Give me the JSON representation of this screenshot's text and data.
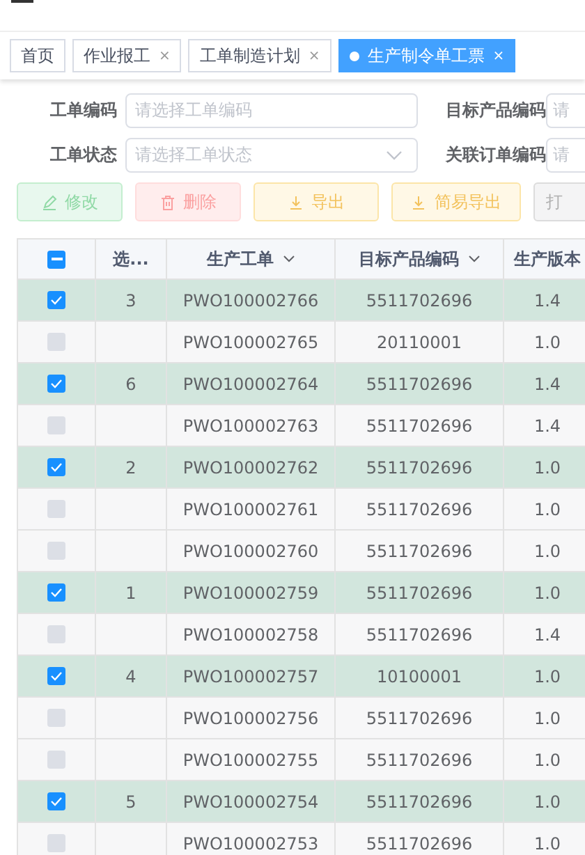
{
  "tabs": [
    {
      "label": "首页",
      "selected": false,
      "closable": false
    },
    {
      "label": "作业报工",
      "selected": false,
      "closable": true
    },
    {
      "label": "工单制造计划",
      "selected": false,
      "closable": true
    },
    {
      "label": "生产制令单工票",
      "selected": true,
      "closable": true
    }
  ],
  "tab_close": "×",
  "filters": [
    {
      "label": "工单编码",
      "placeholder": "请选择工单编码",
      "kind": "input"
    },
    {
      "label": "目标产品编码",
      "placeholder": "请",
      "kind": "input"
    },
    {
      "label": "工单状态",
      "placeholder": "请选择工单状态",
      "kind": "select"
    },
    {
      "label": "关联订单编码",
      "placeholder": "请",
      "kind": "input"
    }
  ],
  "toolbar": [
    {
      "label": "修改",
      "kind": "edit"
    },
    {
      "label": "删除",
      "kind": "delete"
    },
    {
      "label": "导出",
      "kind": "export"
    },
    {
      "label": "简易导出",
      "kind": "export"
    },
    {
      "label": "打",
      "kind": "plain"
    }
  ],
  "table": {
    "header_checkbox_indeterminate": true,
    "columns": [
      {
        "label": "选...",
        "sortable": false
      },
      {
        "label": "生产工单",
        "sortable": true
      },
      {
        "label": "目标产品编码",
        "sortable": true
      },
      {
        "label": "生产版本",
        "sortable": false
      }
    ],
    "rows": [
      {
        "selected": true,
        "order": "3",
        "work_order": "PWO100002766",
        "product_code": "5511702696",
        "version": "1.4"
      },
      {
        "selected": false,
        "order": "",
        "work_order": "PWO100002765",
        "product_code": "20110001",
        "version": "1.0"
      },
      {
        "selected": true,
        "order": "6",
        "work_order": "PWO100002764",
        "product_code": "5511702696",
        "version": "1.4"
      },
      {
        "selected": false,
        "order": "",
        "work_order": "PWO100002763",
        "product_code": "5511702696",
        "version": "1.4"
      },
      {
        "selected": true,
        "order": "2",
        "work_order": "PWO100002762",
        "product_code": "5511702696",
        "version": "1.0"
      },
      {
        "selected": false,
        "order": "",
        "work_order": "PWO100002761",
        "product_code": "5511702696",
        "version": "1.0"
      },
      {
        "selected": false,
        "order": "",
        "work_order": "PWO100002760",
        "product_code": "5511702696",
        "version": "1.0"
      },
      {
        "selected": true,
        "order": "1",
        "work_order": "PWO100002759",
        "product_code": "5511702696",
        "version": "1.0"
      },
      {
        "selected": false,
        "order": "",
        "work_order": "PWO100002758",
        "product_code": "5511702696",
        "version": "1.4"
      },
      {
        "selected": true,
        "order": "4",
        "work_order": "PWO100002757",
        "product_code": "10100001",
        "version": "1.0"
      },
      {
        "selected": false,
        "order": "",
        "work_order": "PWO100002756",
        "product_code": "5511702696",
        "version": "1.0"
      },
      {
        "selected": false,
        "order": "",
        "work_order": "PWO100002755",
        "product_code": "5511702696",
        "version": "1.0"
      },
      {
        "selected": true,
        "order": "5",
        "work_order": "PWO100002754",
        "product_code": "5511702696",
        "version": "1.0"
      },
      {
        "selected": false,
        "order": "",
        "work_order": "PWO100002753",
        "product_code": "5511702696",
        "version": "1.0"
      }
    ]
  }
}
